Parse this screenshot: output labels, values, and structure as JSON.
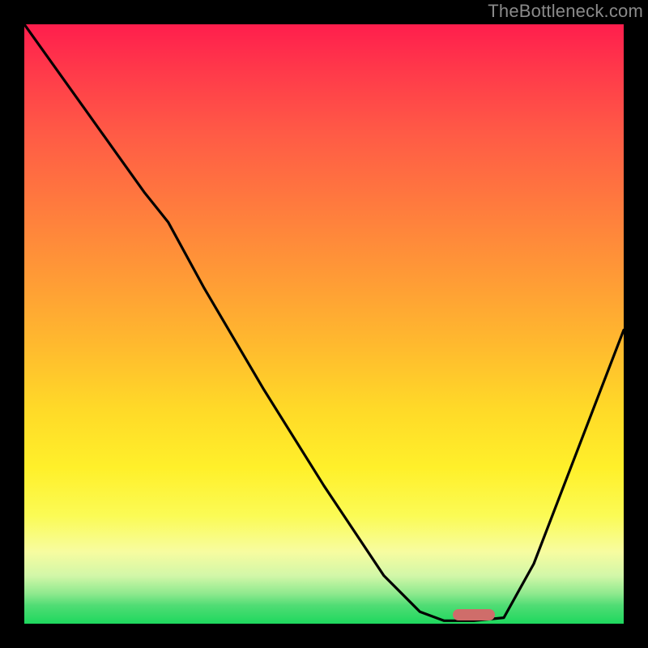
{
  "watermark": "TheBottleneck.com",
  "marker": {
    "x_frac_start": 0.715,
    "x_frac_end": 0.785,
    "y_frac": 0.985,
    "color": "#cf6d6a"
  },
  "chart_data": {
    "type": "line",
    "title": "",
    "xlabel": "",
    "ylabel": "",
    "xlim": [
      0,
      1
    ],
    "ylim": [
      0,
      1
    ],
    "annotations": [
      "TheBottleneck.com"
    ],
    "series": [
      {
        "name": "bottleneck-curve",
        "x": [
          0.0,
          0.05,
          0.1,
          0.15,
          0.2,
          0.24,
          0.3,
          0.4,
          0.5,
          0.6,
          0.66,
          0.7,
          0.75,
          0.8,
          0.85,
          0.9,
          0.95,
          1.0
        ],
        "y": [
          1.0,
          0.93,
          0.86,
          0.79,
          0.72,
          0.67,
          0.56,
          0.39,
          0.23,
          0.08,
          0.02,
          0.005,
          0.005,
          0.01,
          0.1,
          0.23,
          0.36,
          0.49
        ]
      }
    ],
    "background_gradient": {
      "direction": "top-to-bottom",
      "stops": [
        {
          "pos": 0.0,
          "color": "#ff1e4d"
        },
        {
          "pos": 0.3,
          "color": "#ff7a3e"
        },
        {
          "pos": 0.64,
          "color": "#ffd928"
        },
        {
          "pos": 0.88,
          "color": "#f7fca0"
        },
        {
          "pos": 1.0,
          "color": "#1ed85e"
        }
      ]
    },
    "marker_band": {
      "x_start": 0.715,
      "x_end": 0.785,
      "y": 0.015,
      "color": "#cf6d6a",
      "shape": "rounded-bar"
    }
  }
}
